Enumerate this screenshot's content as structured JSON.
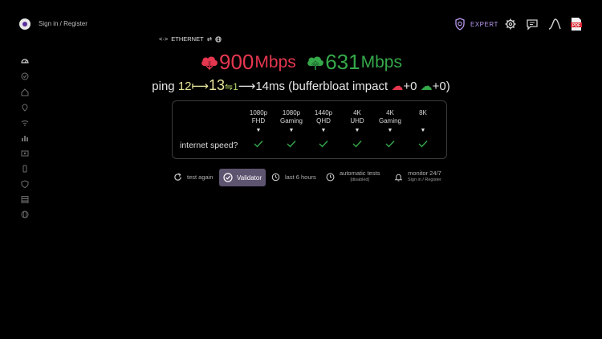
{
  "header": {
    "signin_label": "Sign in / Register",
    "expert_label": "EXPERT",
    "icons": [
      "expert-badge-icon",
      "gear-icon",
      "chat-icon",
      "graph-icon",
      "pdf-icon"
    ],
    "pdf_text": "PDF"
  },
  "connection": {
    "label": "ETHERNET"
  },
  "sidebar": {
    "icons": [
      "speedometer-icon",
      "check-circle-icon",
      "home-icon",
      "location-icon",
      "wifi-icon",
      "chart-icon",
      "router-icon",
      "phone-icon",
      "shield-icon",
      "server-icon",
      "globe-icon"
    ]
  },
  "result": {
    "download": {
      "value": "900",
      "unit": "Mbps"
    },
    "upload": {
      "value": "631",
      "unit": "Mbps"
    }
  },
  "ping": {
    "label": "ping",
    "idle": "12",
    "loaded": "13",
    "down": "1",
    "up": "14",
    "unit": "ms",
    "bufferbloat_label": "(bufferbloat impact",
    "bufferbloat_down": "+0",
    "bufferbloat_up": "+0",
    "close": ")"
  },
  "quality": {
    "question": "internet speed?",
    "columns": [
      {
        "line1": "1080p",
        "line2": "FHD",
        "ok": true
      },
      {
        "line1": "1080p",
        "line2": "Gaming",
        "ok": true
      },
      {
        "line1": "1440p",
        "line2": "QHD",
        "ok": true
      },
      {
        "line1": "4K",
        "line2": "UHD",
        "ok": true
      },
      {
        "line1": "4K",
        "line2": "Gaming",
        "ok": true
      },
      {
        "line1": "8K",
        "line2": "",
        "ok": true
      }
    ],
    "arrow": "▼",
    "check_color": "#35a84a"
  },
  "actions": {
    "test_again": "test again",
    "validator": "Validator",
    "last_hours": "last 6 hours",
    "automatic_tests": "automatic tests",
    "automatic_status": "[disabled]",
    "monitor": "monitor 24/7",
    "monitor_sub": "Sign in / Register"
  },
  "colors": {
    "download": "#e5374f",
    "upload": "#35a84a",
    "accent": "#b99af0",
    "validator_bg": "#5d5470"
  }
}
